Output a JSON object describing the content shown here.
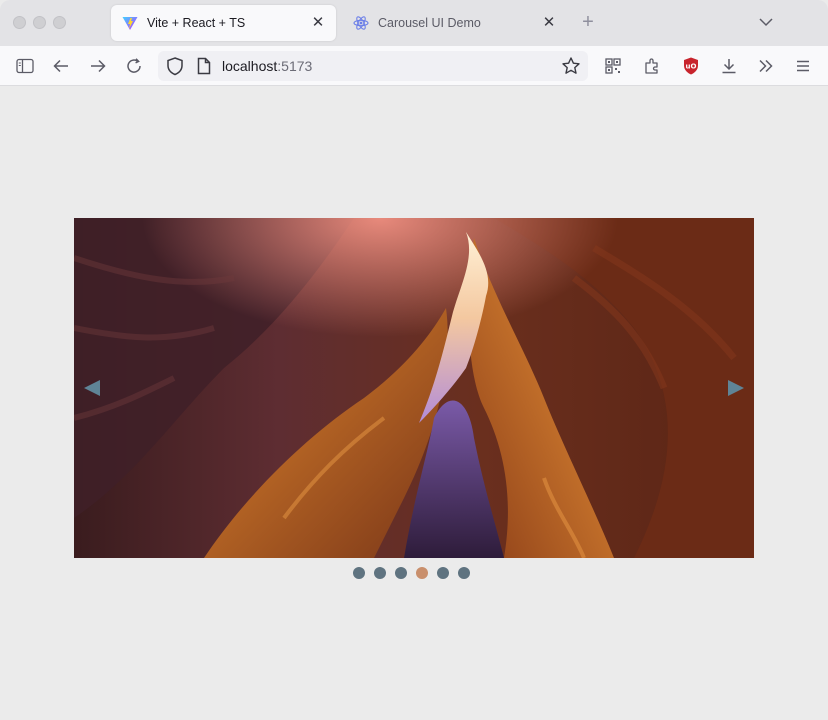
{
  "browser": {
    "tabs": [
      {
        "title": "Vite + React + TS",
        "active": true,
        "favicon": "vite-icon"
      },
      {
        "title": "Carousel UI Demo",
        "active": false,
        "favicon": "react-icon"
      }
    ],
    "url": {
      "host": "localhost",
      "port": ":5173"
    },
    "toolbar_icons": [
      "sidebar-icon",
      "back-icon",
      "forward-icon",
      "reload-icon",
      "shield-icon",
      "page-icon",
      "bookmark-star-icon",
      "qr-code-icon",
      "extensions-icon",
      "ublock-icon",
      "download-icon",
      "overflow-icon",
      "menu-icon"
    ]
  },
  "carousel": {
    "image": "canyon-photo",
    "slide_count": 6,
    "active_index": 3,
    "dot_color": "#5f7380",
    "active_dot_color": "#c98f6c",
    "arrow_color": "#5f8496"
  }
}
